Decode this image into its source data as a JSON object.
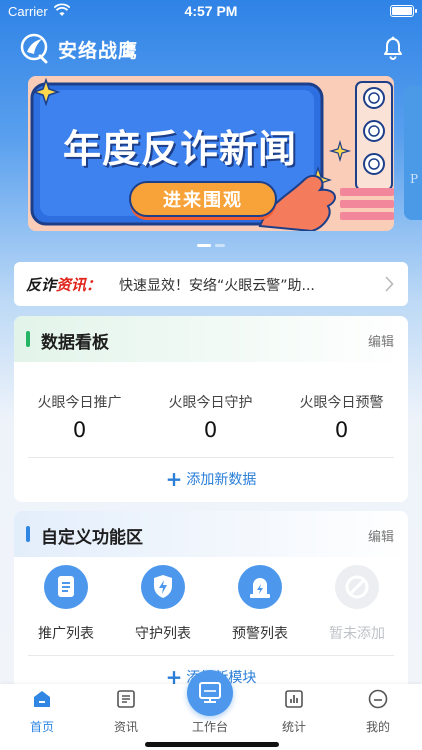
{
  "status_bar": {
    "carrier": "Carrier",
    "time": "4:57 PM"
  },
  "header": {
    "app_name": "安络战鹰"
  },
  "banner": {
    "headline": "年度反诈新闻",
    "button_label": "进来围观",
    "peek_text": "P"
  },
  "news": {
    "tag_black": "反诈",
    "tag_red": "资讯：",
    "text": "快速显效！安络“火眼云警”助..."
  },
  "data_board": {
    "title": "数据看板",
    "edit_label": "编辑",
    "stats": [
      {
        "label": "火眼今日推广",
        "value": "0"
      },
      {
        "label": "火眼今日守护",
        "value": "0"
      },
      {
        "label": "火眼今日预警",
        "value": "0"
      }
    ],
    "add_label": "添加新数据"
  },
  "custom_area": {
    "title": "自定义功能区",
    "edit_label": "编辑",
    "items": [
      {
        "label": "推广列表",
        "icon": "list-doc-icon"
      },
      {
        "label": "守护列表",
        "icon": "shield-bolt-icon"
      },
      {
        "label": "预警列表",
        "icon": "alarm-icon"
      },
      {
        "label": "暂未添加",
        "icon": "disabled-icon"
      }
    ],
    "add_label": "添加新模块"
  },
  "tabbar": {
    "items": [
      {
        "label": "首页"
      },
      {
        "label": "资讯"
      },
      {
        "label": "工作台"
      },
      {
        "label": "统计"
      },
      {
        "label": "我的"
      }
    ]
  },
  "colors": {
    "primary": "#2f86e3",
    "green_accent": "#25b565",
    "red_tag": "#e0241a"
  }
}
